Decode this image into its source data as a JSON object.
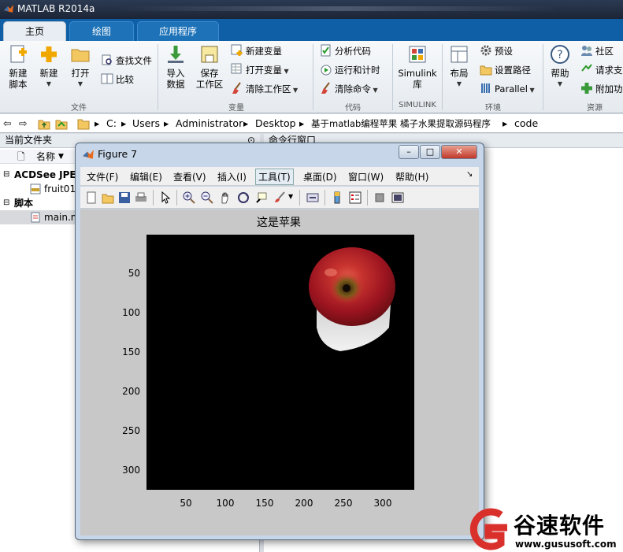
{
  "app": {
    "title": "MATLAB R2014a"
  },
  "tabs": [
    "主页",
    "绘图",
    "应用程序"
  ],
  "ribbon": {
    "file": {
      "group": "文件",
      "new_script": [
        "新建",
        "脚本"
      ],
      "new": "新建",
      "open": "打开",
      "find_files": "查找文件",
      "compare": "比较"
    },
    "variable": {
      "group": "变量",
      "import": [
        "导入",
        "数据"
      ],
      "save": [
        "保存",
        "工作区"
      ],
      "new_var": "新建变量",
      "open_var": "打开变量",
      "clear_ws": "清除工作区"
    },
    "code": {
      "group": "代码",
      "analyze": "分析代码",
      "run_time": "运行和计时",
      "clear_cmd": "清除命令"
    },
    "simulink": {
      "group": "SIMULINK",
      "label": [
        "Simulink",
        "库"
      ]
    },
    "env": {
      "group": "环境",
      "layout": "布局",
      "prefs": "预设",
      "set_path": "设置路径",
      "parallel": "Parallel"
    },
    "resources": {
      "group": "资源",
      "help": "帮助",
      "community": "社区",
      "request": "请求支",
      "addons": "附加功"
    }
  },
  "path": [
    "C:",
    "Users",
    "Administrator",
    "Desktop",
    "基于matlab编程苹果 橘子水果提取源码程序",
    "code"
  ],
  "left_pane": {
    "title": "当前文件夹",
    "column": "名称",
    "groups": [
      {
        "label": "ACDSee JPE",
        "items": [
          "fruit01."
        ]
      },
      {
        "label": "脚本",
        "items": [
          "main.m"
        ]
      }
    ]
  },
  "cmd_pane": {
    "title": "命令行窗口"
  },
  "figure": {
    "title": "Figure 7",
    "menu": [
      "文件(F)",
      "编辑(E)",
      "查看(V)",
      "插入(I)",
      "工具(T)",
      "桌面(D)",
      "窗口(W)",
      "帮助(H)"
    ],
    "plot_title": "这是苹果",
    "x_ticks": [
      "50",
      "100",
      "150",
      "200",
      "250",
      "300"
    ],
    "y_ticks": [
      "50",
      "100",
      "150",
      "200",
      "250",
      "300"
    ]
  },
  "watermark": {
    "brand": "谷速软件",
    "url": "www.gususoft.com",
    "color": "#d9302c"
  },
  "colors": {
    "ribbon_tab": "#0f5fa6",
    "apple_red": "#b61c26",
    "plot_bg": "#000000"
  }
}
